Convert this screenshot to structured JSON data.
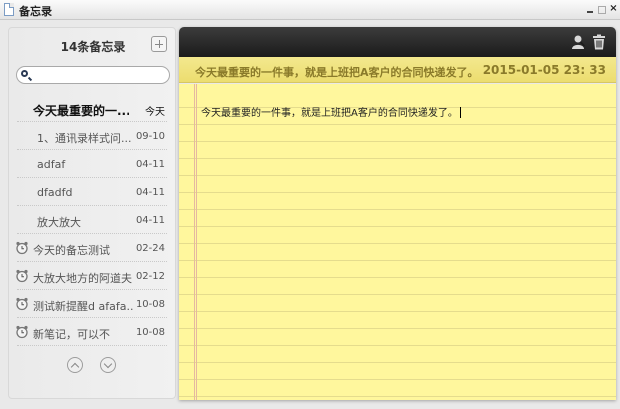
{
  "window": {
    "title": "备忘录",
    "close_label": "×"
  },
  "sidebar": {
    "count_label": "14条备忘录",
    "search": {
      "placeholder": "",
      "value": ""
    },
    "notes": [
      {
        "title": "今天最重要的一...",
        "date": "今天",
        "alarm": false,
        "selected": true
      },
      {
        "title": "1、通讯录样式问...",
        "date": "09-10",
        "alarm": false,
        "selected": false
      },
      {
        "title": "adfaf",
        "date": "04-11",
        "alarm": false,
        "selected": false
      },
      {
        "title": "dfadfd",
        "date": "04-11",
        "alarm": false,
        "selected": false
      },
      {
        "title": "放大放大",
        "date": "04-11",
        "alarm": false,
        "selected": false
      },
      {
        "title": "今天的备忘测试",
        "date": "02-24",
        "alarm": true,
        "selected": false
      },
      {
        "title": "大放大地方的阿道夫",
        "date": "02-12",
        "alarm": true,
        "selected": false
      },
      {
        "title": "测试新提醒d afafa...",
        "date": "10-08",
        "alarm": true,
        "selected": false
      },
      {
        "title": "新笔记，可以不",
        "date": "10-08",
        "alarm": true,
        "selected": false
      }
    ]
  },
  "editor": {
    "header_title": "今天最重要的一件事，就是上班把A客户的合同快递发了。",
    "header_date": "2015-01-05 23: 33",
    "body": "今天最重要的一件事，就是上班把A客户的合同快递发了。"
  },
  "colors": {
    "paper": "#fff79d",
    "header": "#ecdd6f",
    "toolbar": "#1b1b1b",
    "header_text": "#8a7a2a"
  }
}
